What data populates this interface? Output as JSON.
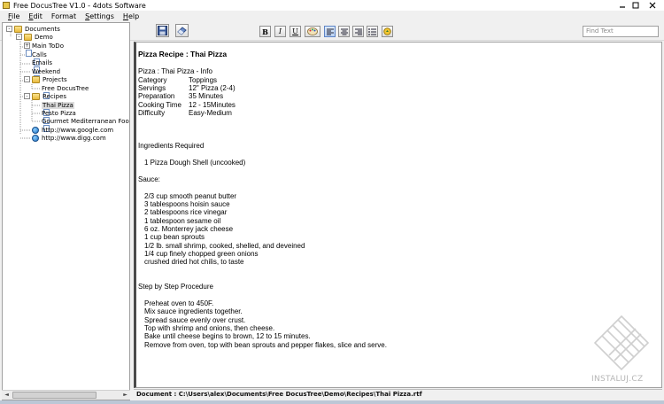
{
  "window": {
    "title": "Free DocusTree V1.0 - 4dots Software",
    "controls": [
      "minimize",
      "maximize",
      "close"
    ]
  },
  "menu": [
    {
      "label": "File",
      "hotkey": "F",
      "rest": "ile"
    },
    {
      "label": "Edit",
      "hotkey": "E",
      "rest": "dit"
    },
    {
      "label": "Format",
      "hotkey": "",
      "rest": "Format"
    },
    {
      "label": "Settings",
      "hotkey": "S",
      "rest": "ettings"
    },
    {
      "label": "Help",
      "hotkey": "H",
      "rest": "elp"
    }
  ],
  "toolbar": {
    "save_icon": "save-icon",
    "erase_icon": "eraser-icon",
    "bold": "B",
    "italic": "I",
    "underline": "U",
    "color_icon": "palette-icon",
    "align_left_icon": "align-left-icon",
    "align_center_icon": "align-center-icon",
    "align_right_icon": "align-right-icon",
    "list_icon": "bullet-list-icon",
    "image_icon": "insert-image-icon",
    "find_placeholder": "Find Text"
  },
  "tree": {
    "nodes": [
      {
        "label": "Documents",
        "icon": "folder",
        "depth": 0,
        "expander": "-"
      },
      {
        "label": "Demo",
        "icon": "folder",
        "depth": 1,
        "expander": "-"
      },
      {
        "label": "Main ToDo",
        "icon": "doc",
        "depth": 2,
        "expander": "+"
      },
      {
        "label": "Calls",
        "icon": "doc",
        "depth": 2,
        "expander": ""
      },
      {
        "label": "Emails",
        "icon": "doc",
        "depth": 2,
        "expander": ""
      },
      {
        "label": "Weekend",
        "icon": "doc",
        "depth": 2,
        "expander": ""
      },
      {
        "label": "Projects",
        "icon": "folder",
        "depth": 2,
        "expander": "-"
      },
      {
        "label": "Free DocusTree",
        "icon": "doc",
        "depth": 3,
        "expander": ""
      },
      {
        "label": "Recipes",
        "icon": "folder",
        "depth": 2,
        "expander": "-"
      },
      {
        "label": "Thai Pizza",
        "icon": "doc",
        "depth": 3,
        "expander": "",
        "selected": true
      },
      {
        "label": "Pesto Pizza",
        "icon": "doc",
        "depth": 3,
        "expander": ""
      },
      {
        "label": "Gourmet Mediterranean Food F",
        "icon": "doc",
        "depth": 3,
        "expander": ""
      },
      {
        "label": "http://www.google.com",
        "icon": "globe",
        "depth": 2,
        "expander": ""
      },
      {
        "label": "http://www.digg.com",
        "icon": "globe",
        "depth": 2,
        "expander": ""
      }
    ]
  },
  "document": {
    "title": "Pizza Recipe : Thai Pizza",
    "info_heading": "Pizza : Thai Pizza - Info",
    "info": [
      {
        "key": "Category",
        "value": "Toppings"
      },
      {
        "key": "Servings",
        "value": "12\" Pizza (2-4)"
      },
      {
        "key": "Preparation",
        "value": "35 Minutes"
      },
      {
        "key": "Cooking Time",
        "value": "12 - 15Minutes"
      },
      {
        "key": "Difficulty",
        "value": "Easy-Medium"
      }
    ],
    "ingredients_heading": "Ingredients Required",
    "shell": "1 Pizza Dough Shell (uncooked)",
    "sauce_heading": "Sauce:",
    "sauce_items": [
      "2/3 cup smooth peanut butter",
      "3 tablespoons hoisin sauce",
      "2 tablespoons rice vinegar",
      "1 tablespoon sesame oil",
      "6 oz. Monterrey jack cheese",
      "1 cup bean sprouts",
      "1/2 lb. small shrimp, cooked, shelled, and deveined",
      "1/4 cup finely chopped green onions",
      "crushed dried hot chilis, to taste"
    ],
    "procedure_heading": "Step by Step Procedure",
    "procedure": [
      "Preheat oven to 450F.",
      "Mix sauce ingredients together.",
      "Spread sauce evenly over crust.",
      "Top with shrimp and onions, then cheese.",
      "Bake until cheese begins to brown, 12 to 15 minutes.",
      "Remove from oven, top with bean sprouts and pepper flakes, slice and serve."
    ]
  },
  "status": {
    "path": "Document : C:\\Users\\alex\\Documents\\Free DocusTree\\Demo\\Recipes\\Thai Pizza.rtf"
  },
  "watermark": {
    "text": "INSTALUJ.CZ"
  }
}
